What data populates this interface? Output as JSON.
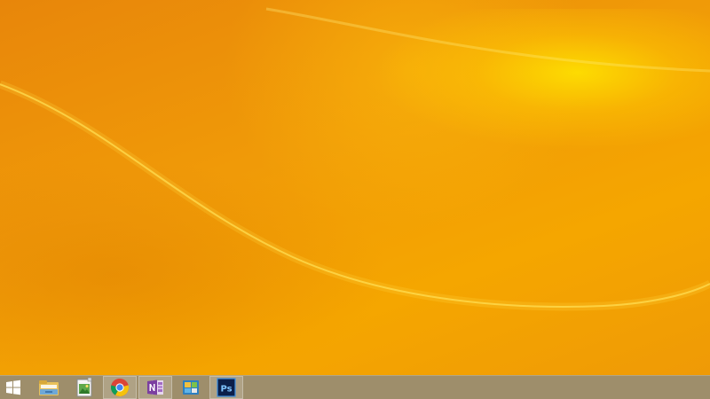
{
  "desktop": {
    "wallpaper_colors": {
      "base": "#ef9a06",
      "highlight": "#ffe400",
      "shadow": "#e3850a"
    }
  },
  "taskbar": {
    "background": "#9e8e6b",
    "start_icon": "windows-logo-icon",
    "items": [
      {
        "icon": "file-explorer-icon",
        "running": false
      },
      {
        "icon": "photo-viewer-icon",
        "running": false
      },
      {
        "icon": "chrome-icon",
        "running": true
      },
      {
        "icon": "onenote-icon",
        "running": true
      },
      {
        "icon": "windows-app-icon",
        "running": false
      },
      {
        "icon": "photoshop-icon",
        "running": true,
        "label": "Ps"
      }
    ]
  }
}
